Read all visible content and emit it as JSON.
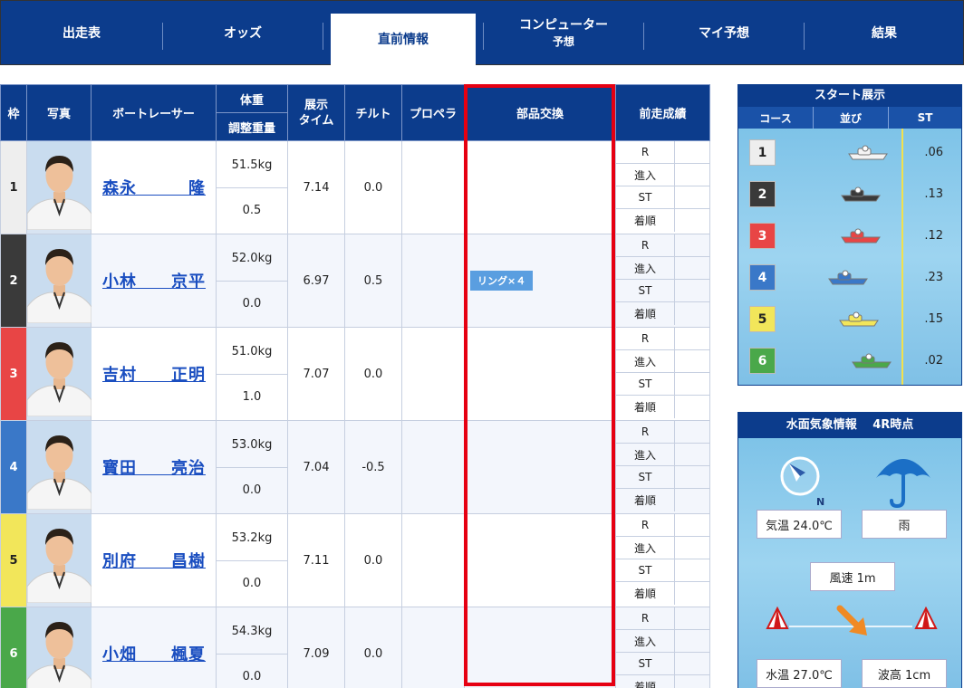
{
  "tabs": [
    {
      "label": "出走表"
    },
    {
      "label": "オッズ"
    },
    {
      "label": "直前情報"
    },
    {
      "label": "コンピューター",
      "label2": "予想"
    },
    {
      "label": "マイ予想"
    },
    {
      "label": "結果"
    }
  ],
  "table": {
    "headers": {
      "frame": "枠",
      "photo": "写真",
      "racer": "ボートレーサー",
      "weight": "体重",
      "adjust": "調整重量",
      "exhibit1": "展示",
      "exhibit2": "タイム",
      "tilt": "チルト",
      "propeller": "プロペラ",
      "parts": "部品交換",
      "prev": "前走成績"
    },
    "record_labels": [
      "R",
      "進入",
      "ST",
      "着順"
    ],
    "rows": [
      {
        "frame": "1",
        "color": "#eeeeee",
        "text_color": "#222222",
        "name": "森永　　　隆",
        "weight": "51.5kg",
        "adjust": "0.5",
        "time": "7.14",
        "tilt": "0.0",
        "parts": ""
      },
      {
        "frame": "2",
        "color": "#3a3a3a",
        "text_color": "#ffffff",
        "name": "小林　　京平",
        "weight": "52.0kg",
        "adjust": "0.0",
        "time": "6.97",
        "tilt": "0.5",
        "parts": "リング×４"
      },
      {
        "frame": "3",
        "color": "#e84545",
        "text_color": "#ffffff",
        "name": "吉村　　正明",
        "weight": "51.0kg",
        "adjust": "1.0",
        "time": "7.07",
        "tilt": "0.0",
        "parts": ""
      },
      {
        "frame": "4",
        "color": "#3a78c8",
        "text_color": "#ffffff",
        "name": "寳田　　亮治",
        "weight": "53.0kg",
        "adjust": "0.0",
        "time": "7.04",
        "tilt": "-0.5",
        "parts": ""
      },
      {
        "frame": "5",
        "color": "#f2e65a",
        "text_color": "#222222",
        "name": "別府　　昌樹",
        "weight": "53.2kg",
        "adjust": "0.0",
        "time": "7.11",
        "tilt": "0.0",
        "parts": ""
      },
      {
        "frame": "6",
        "color": "#4aa84a",
        "text_color": "#ffffff",
        "name": "小畑　　楓夏",
        "weight": "54.3kg",
        "adjust": "0.0",
        "time": "7.09",
        "tilt": "0.0",
        "parts": ""
      }
    ]
  },
  "start_display": {
    "title": "スタート展示",
    "col_course": "コース",
    "col_order": "並び",
    "col_st": "ST",
    "rows": [
      {
        "course": "1",
        "color": "#eeeeee",
        "text_color": "#222222",
        "st": ".06",
        "boat_color": "#f4f4f4"
      },
      {
        "course": "2",
        "color": "#3a3a3a",
        "text_color": "#ffffff",
        "st": ".13",
        "boat_color": "#3a3a3a"
      },
      {
        "course": "3",
        "color": "#e84545",
        "text_color": "#ffffff",
        "st": ".12",
        "boat_color": "#e84545"
      },
      {
        "course": "4",
        "color": "#3a78c8",
        "text_color": "#ffffff",
        "st": ".23",
        "boat_color": "#3a78c8"
      },
      {
        "course": "5",
        "color": "#f2e65a",
        "text_color": "#222222",
        "st": ".15",
        "boat_color": "#f2e65a"
      },
      {
        "course": "6",
        "color": "#4aa84a",
        "text_color": "#ffffff",
        "st": ".02",
        "boat_color": "#4aa84a"
      }
    ]
  },
  "weather": {
    "title": "水面気象情報　 4R時点",
    "wind_dir_label": "N",
    "temperature": "気温 24.0℃",
    "weather": "雨",
    "wind_speed": "風速 1m",
    "water_temp": "水温 27.0℃",
    "wave": "波高 1cm"
  }
}
